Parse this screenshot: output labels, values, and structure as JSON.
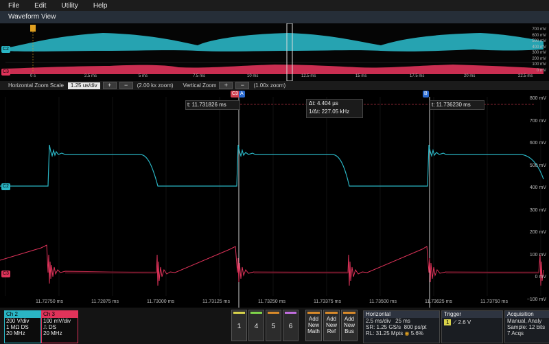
{
  "menu": [
    "File",
    "Edit",
    "Utility",
    "Help"
  ],
  "waveform_view": {
    "title": "Waveform View"
  },
  "overview": {
    "scale_labels": [
      "700 mV",
      "600 mV",
      "500 mV",
      "400 mV",
      "300 mV",
      "200 mV",
      "100 mV",
      "0 mV"
    ],
    "time_labels": [
      "0 s",
      "2.5 ms",
      "5 ms",
      "7.5 ms",
      "10 ms",
      "12.5 ms",
      "15 ms",
      "17.5 ms",
      "20 ms",
      "22.5 ms"
    ],
    "ch2_tag": "C2",
    "ch3_tag": "C3"
  },
  "zoom": {
    "h_label": "Horizontal Zoom Scale",
    "h_value": "1.25 us/div",
    "h_info": "(2.00 kx zoom)",
    "v_label": "Vertical Zoom",
    "v_info": "(1.00x zoom)",
    "plus": "+",
    "minus": "−"
  },
  "main": {
    "voltage_labels": [
      "800 mV",
      "700 mV",
      "600 mV",
      "500 mV",
      "400 mV",
      "300 mV",
      "200 mV",
      "100 mV",
      "0 mV",
      "−100 mV"
    ],
    "time_labels": [
      "11.72750 ms",
      "11.72875 ms",
      "11.73000 ms",
      "11.73125 ms",
      "11.73250 ms",
      "11.73375 ms",
      "11.73500 ms",
      "11.73625 ms",
      "11.73750 ms"
    ],
    "ch2_tag": "C2",
    "ch3_tag": "C3",
    "cursor_a": "A",
    "cursor_b": "B",
    "cursor_c3_tag": "C3",
    "readout_a": "t: 11.731826 ms",
    "readout_b": "t: 11.736230 ms",
    "readout_dt": "Δt: 4.404 µs",
    "readout_inv": "1/Δt: 227.05 kHz"
  },
  "ch2": {
    "name": "Ch 2",
    "vdiv": "200 V/div",
    "imp": "1 MΩ",
    "ds": "DS",
    "bw": "20 MHz",
    "color": "#2ab5c4"
  },
  "ch3": {
    "name": "Ch 3",
    "vdiv": "100 mV/div",
    "ds": "DS",
    "bw": "20 MHz",
    "color": "#e0335a"
  },
  "num_buttons": [
    {
      "label": "1",
      "color": "#d8d24a"
    },
    {
      "label": "4",
      "color": "#7fd34a"
    },
    {
      "label": "5",
      "color": "#d88a2a"
    },
    {
      "label": "6",
      "color": "#c26ee0"
    }
  ],
  "new_buttons": [
    {
      "l1": "Add",
      "l2": "New",
      "l3": "Math"
    },
    {
      "l1": "Add",
      "l2": "New",
      "l3": "Ref"
    },
    {
      "l1": "Add",
      "l2": "New",
      "l3": "Bus"
    }
  ],
  "horizontal": {
    "title": "Horizontal",
    "scale": "2.5 ms/div",
    "pos": "25 ms",
    "sr": "SR: 1.25 GS/s",
    "pt": "800 ps/pt",
    "rl": "RL: 31.25 Mpts",
    "pct": "5.6%"
  },
  "trigger": {
    "title": "Trigger",
    "src": "1",
    "level": "2.6 V"
  },
  "acquisition": {
    "title": "Acquisition",
    "mode": "Manual,",
    "mode2": "Analy",
    "sample": "Sample: 12 bits",
    "acqs": "7 Acqs"
  }
}
